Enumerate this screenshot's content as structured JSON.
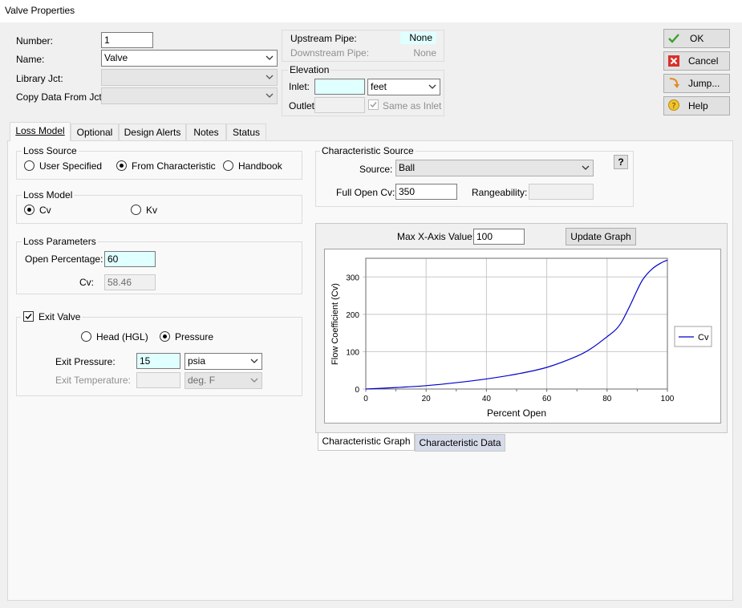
{
  "window": {
    "title": "Valve Properties"
  },
  "general": {
    "number_label": "Number:",
    "number_value": "1",
    "name_label": "Name:",
    "name_value": "Valve",
    "library_label": "Library Jct:",
    "library_value": "",
    "copy_label": "Copy Data From Jct...",
    "copy_value": ""
  },
  "pipes": {
    "upstream_label": "Upstream Pipe:",
    "upstream_value": "None",
    "downstream_label": "Downstream Pipe:",
    "downstream_value": "None"
  },
  "elevation": {
    "title": "Elevation",
    "inlet_label": "Inlet:",
    "inlet_value": "",
    "inlet_unit": "feet",
    "outlet_label": "Outlet:",
    "outlet_value": "",
    "same_as_inlet_label": "Same as Inlet",
    "same_as_inlet_checked": true
  },
  "buttons": {
    "ok": "OK",
    "cancel": "Cancel",
    "jump": "Jump...",
    "help": "Help"
  },
  "tabs": [
    {
      "label": "Loss Model",
      "active": true
    },
    {
      "label": "Optional"
    },
    {
      "label": "Design Alerts"
    },
    {
      "label": "Notes"
    },
    {
      "label": "Status"
    }
  ],
  "loss_source": {
    "title": "Loss Source",
    "options": [
      "User Specified",
      "From Characteristic",
      "Handbook"
    ],
    "selected": "From Characteristic"
  },
  "loss_model": {
    "title": "Loss Model",
    "options": [
      "Cv",
      "Kv"
    ],
    "selected": "Cv"
  },
  "loss_parameters": {
    "title": "Loss Parameters",
    "open_pct_label": "Open Percentage:",
    "open_pct_value": "60",
    "cv_label": "Cv:",
    "cv_value": "58.46"
  },
  "exit_valve": {
    "label": "Exit Valve",
    "checked": true,
    "options": [
      "Head (HGL)",
      "Pressure"
    ],
    "selected": "Pressure",
    "exit_pressure_label": "Exit Pressure:",
    "exit_pressure_value": "15",
    "exit_pressure_unit": "psia",
    "exit_temp_label": "Exit Temperature:",
    "exit_temp_value": "",
    "exit_temp_unit": "deg. F"
  },
  "characteristic_source": {
    "title": "Characteristic Source",
    "help_label": "?",
    "source_label": "Source:",
    "source_value": "Ball",
    "full_open_cv_label": "Full Open Cv:",
    "full_open_cv_value": "350",
    "rangeability_label": "Rangeability:",
    "rangeability_value": ""
  },
  "graph": {
    "max_x_label": "Max X-Axis Value:",
    "max_x_value": "100",
    "update_button": "Update Graph",
    "xlabel": "Percent Open",
    "ylabel": "Flow Coefficient (Cv)",
    "legend": "Cv",
    "x_ticks": [
      "0",
      "20",
      "40",
      "60",
      "80",
      "100"
    ],
    "y_ticks": [
      "0",
      "100",
      "200",
      "300"
    ]
  },
  "bottom_tabs": [
    {
      "label": "Characteristic Graph",
      "active": true
    },
    {
      "label": "Characteristic Data"
    }
  ],
  "chart_data": {
    "type": "line",
    "title": "",
    "xlabel": "Percent Open",
    "ylabel": "Flow Coefficient (Cv)",
    "xlim": [
      0,
      100
    ],
    "ylim": [
      0,
      350
    ],
    "grid": true,
    "legend": "right",
    "series": [
      {
        "name": "Cv",
        "color": "#0000cc",
        "x": [
          0,
          10,
          20,
          30,
          40,
          50,
          60,
          70,
          75,
          80,
          83,
          85,
          88,
          90,
          92,
          95,
          98,
          100
        ],
        "y": [
          0,
          4,
          9,
          17,
          27,
          40,
          58,
          88,
          110,
          140,
          160,
          182,
          230,
          265,
          295,
          322,
          338,
          345
        ]
      }
    ]
  },
  "colors": {
    "cyan_field": "#e0ffff",
    "line": "#0000cc"
  }
}
